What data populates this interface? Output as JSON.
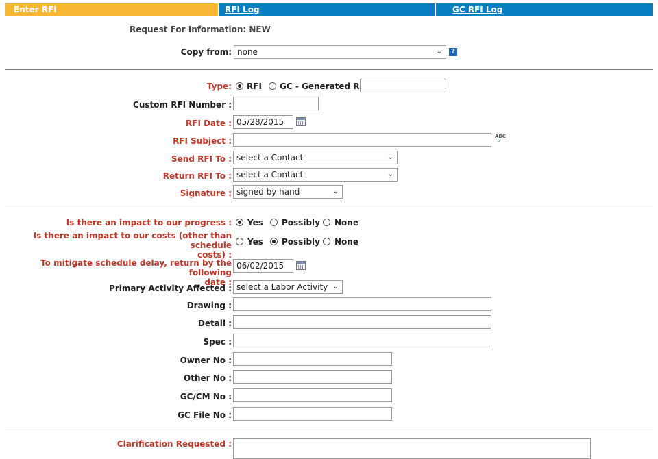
{
  "tabs": {
    "enter": "Enter RFI",
    "log": "RFI Log",
    "gc_log": "GC RFI Log"
  },
  "header": {
    "title": "Request For Information: NEW"
  },
  "copy_from": {
    "label": "Copy from:",
    "value": "none",
    "help": "?"
  },
  "type": {
    "label": "Type:",
    "opt_rfi": "RFI",
    "opt_gc": "GC - Generated RFI:",
    "selected": "RFI"
  },
  "custom_number": {
    "label": "Custom RFI Number :",
    "value": ""
  },
  "rfi_date": {
    "label": "RFI Date :",
    "value": "05/28/2015"
  },
  "rfi_subject": {
    "label": "RFI Subject :",
    "value": ""
  },
  "send_to": {
    "label": "Send RFI To :",
    "value": "select a Contact"
  },
  "return_to": {
    "label": "Return RFI To :",
    "value": "select a Contact"
  },
  "signature": {
    "label": "Signature :",
    "value": "signed by hand"
  },
  "impact_progress": {
    "label": "Is there an impact to our progress :",
    "selected": "Yes"
  },
  "impact_costs": {
    "label_line1": "Is there an impact to our costs (other than schedule",
    "label_line2": "costs) :",
    "selected": "Possibly"
  },
  "options": {
    "yes": "Yes",
    "possibly": "Possibly",
    "none": "None"
  },
  "mitigate": {
    "label_line1": "To mitigate schedule delay, return by the following",
    "label_line2": "date :",
    "value": "06/02/2015"
  },
  "activity": {
    "label": "Primary Activity Affected :",
    "value": "select a Labor Activity"
  },
  "drawing": {
    "label": "Drawing :",
    "value": ""
  },
  "detail": {
    "label": "Detail :",
    "value": ""
  },
  "spec": {
    "label": "Spec :",
    "value": ""
  },
  "owner_no": {
    "label": "Owner No :",
    "value": ""
  },
  "other_no": {
    "label": "Other No :",
    "value": ""
  },
  "gccm_no": {
    "label": "GC/CM No :",
    "value": ""
  },
  "gc_file_no": {
    "label": "GC File No :",
    "value": ""
  },
  "clarification": {
    "label": "Clarification Requested :",
    "value": ""
  },
  "spellcheck": {
    "text": "ABC"
  }
}
